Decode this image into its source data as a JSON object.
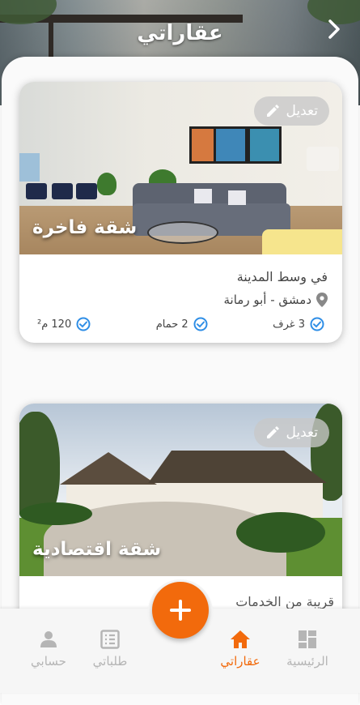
{
  "header": {
    "title": "عقاراتي"
  },
  "listings": [
    {
      "title": "شقة فاخرة",
      "edit_label": "تعديل",
      "description": "في وسط المدينة",
      "location": "دمشق - أبو رمانة",
      "features": {
        "rooms": "3 غرف",
        "baths": "2 حمام",
        "area": "120 م²"
      }
    },
    {
      "title": "شقة اقتصادية",
      "edit_label": "تعديل",
      "description": "قريبة من الخدمات"
    }
  ],
  "bottom_nav": {
    "home": "الرئيسية",
    "my_properties": "عقاراتي",
    "my_requests": "طلباتي",
    "my_account": "حسابي"
  },
  "colors": {
    "accent": "#f26a0c",
    "inactive": "#b5b5b5",
    "check": "#2f8ee6"
  },
  "icons": [
    "chevron-right-icon",
    "pencil-icon",
    "location-pin-icon",
    "check-circle-icon",
    "dashboard-icon",
    "home-icon",
    "list-icon",
    "person-icon",
    "plus-icon"
  ]
}
